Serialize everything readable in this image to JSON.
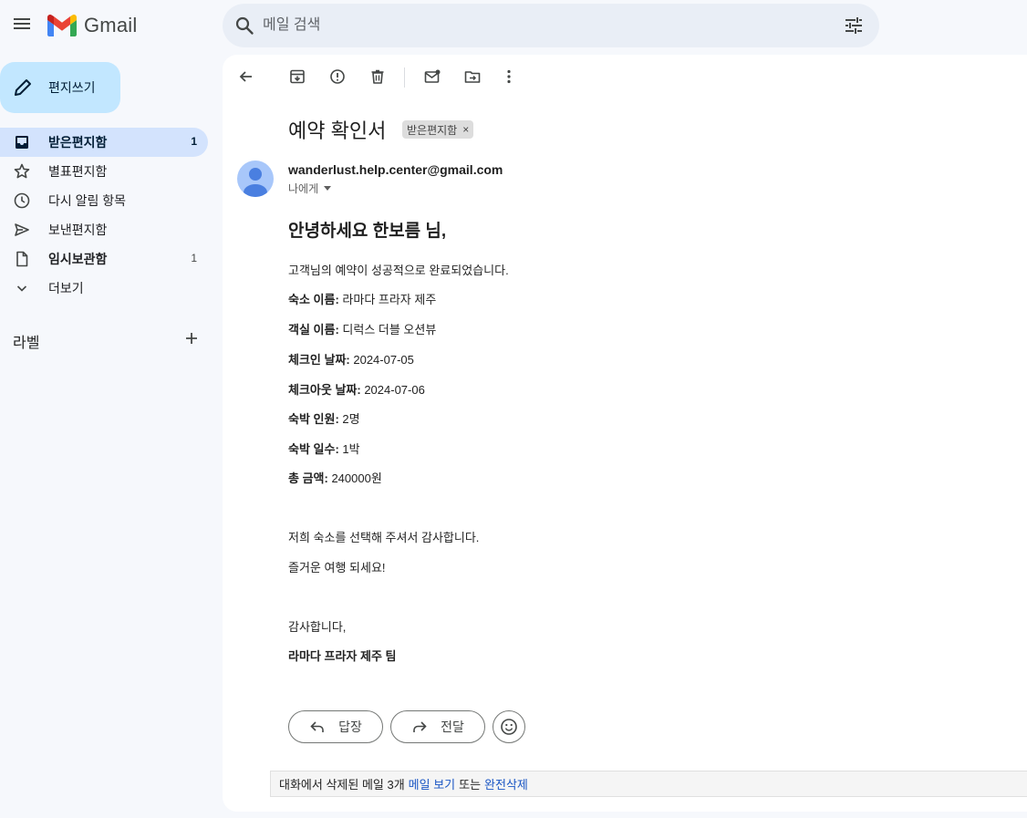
{
  "app": {
    "name": "Gmail"
  },
  "search": {
    "placeholder": "메일 검색"
  },
  "compose": {
    "label": "편지쓰기"
  },
  "sidebar": {
    "items": [
      {
        "label": "받은편지함",
        "count": "1",
        "active": true
      },
      {
        "label": "별표편지함",
        "count": ""
      },
      {
        "label": "다시 알림 항목",
        "count": ""
      },
      {
        "label": "보낸편지함",
        "count": ""
      },
      {
        "label": "임시보관함",
        "count": "1"
      },
      {
        "label": "더보기",
        "count": ""
      }
    ],
    "labels_title": "라벨"
  },
  "email": {
    "subject": "예약 확인서",
    "label_chip": "받은편지함",
    "chip_close": "×",
    "sender": "wanderlust.help.center@gmail.com",
    "recipient": "나에게",
    "greeting": "안녕하세요 한보름 님,",
    "intro": "고객님의 예약이 성공적으로 완료되었습니다.",
    "details": [
      {
        "key": "숙소 이름:",
        "value": " 라마다 프라자 제주"
      },
      {
        "key": "객실 이름:",
        "value": " 디럭스 더블 오션뷰"
      },
      {
        "key": "체크인 날짜:",
        "value": " 2024-07-05"
      },
      {
        "key": "체크아웃 날짜:",
        "value": " 2024-07-06"
      },
      {
        "key": "숙박 인원:",
        "value": " 2명"
      },
      {
        "key": "숙박 일수:",
        "value": " 1박"
      },
      {
        "key": "총 금액:",
        "value": " 240000원"
      }
    ],
    "thanks": "저희 숙소를 선택해 주셔서 감사합니다.",
    "wish": "즐거운 여행 되세요!",
    "closing": "감사합니다,",
    "signature": "라마다 프라자 제주 팀"
  },
  "actions": {
    "reply": "답장",
    "forward": "전달"
  },
  "deleted_notice": {
    "text": "대화에서 삭제된 메일 3개",
    "view_link": "메일 보기",
    "or": "또는",
    "delete_link": "완전삭제"
  },
  "colors": {
    "accent": "#c2e7ff",
    "active_nav": "#d3e3fd",
    "link": "#1a56c4"
  }
}
